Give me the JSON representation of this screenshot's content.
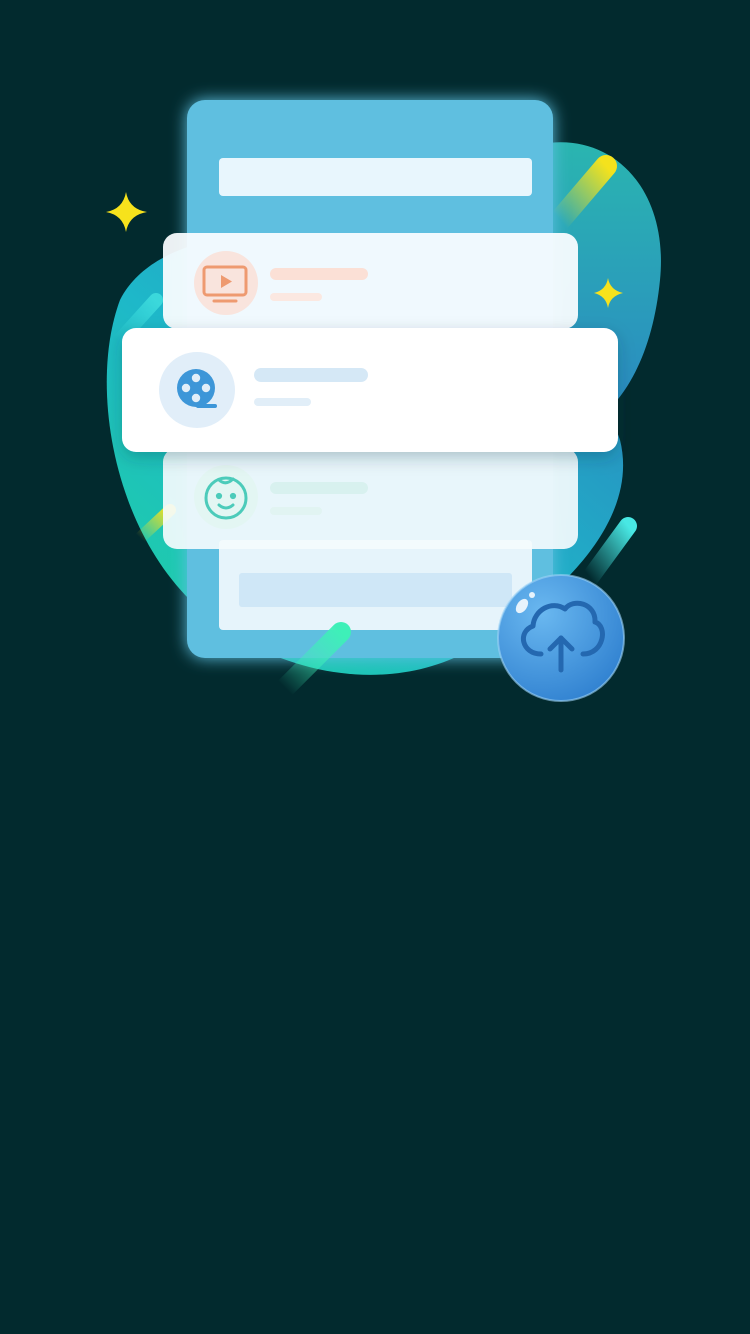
{
  "screen": {
    "background": "#022a2e"
  },
  "illustration": {
    "icons": [
      "tv-play-icon",
      "film-reel-icon",
      "baby-face-icon",
      "cloud-upload-icon",
      "sparkle-icon"
    ],
    "colors": {
      "panel": "#5ebfe0",
      "card": "#ffffff",
      "blob_teal": "#27c9a6",
      "blob_blue": "#2e8fc4",
      "accent_yellow": "#f4e21d",
      "accent_cyan": "#3fe0e8",
      "tv_icon": "#f0a17c",
      "film_icon": "#3d96d8",
      "baby_icon": "#4dcbbb",
      "upload_button": "#3e96dd"
    }
  }
}
